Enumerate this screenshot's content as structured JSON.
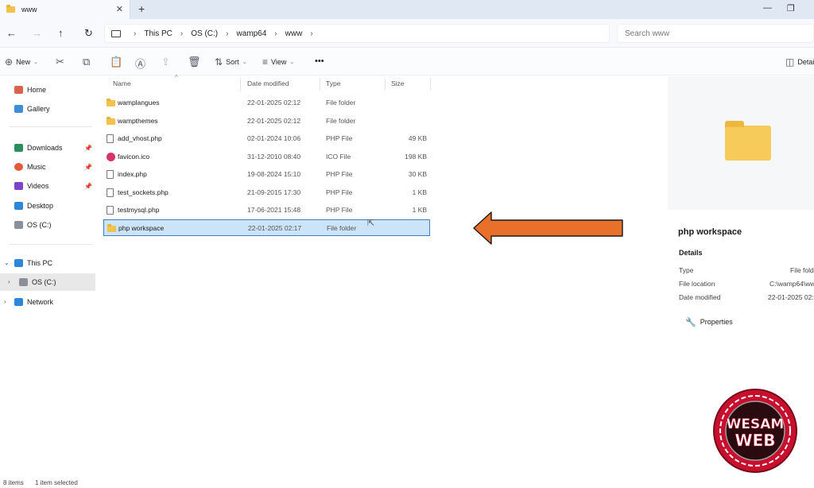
{
  "window": {
    "tab_title": "www",
    "tab_close": "✕",
    "new_tab": "+",
    "minimize": "—",
    "restore": "❐"
  },
  "address": {
    "breadcrumb": [
      "This PC",
      "OS (C:)",
      "wamp64",
      "www"
    ],
    "search_placeholder": "Search www"
  },
  "command_bar": {
    "new_label": "New",
    "sort_label": "Sort",
    "view_label": "View",
    "more_label": "•••",
    "details_label": "Detai"
  },
  "sidebar": {
    "items": [
      {
        "label": "Home",
        "icon": "home-icon",
        "color": "#d9634a"
      },
      {
        "label": "Gallery",
        "icon": "gallery-icon",
        "color": "#3c8fd6"
      },
      {
        "label": "Downloads",
        "icon": "downloads-icon",
        "color": "#2a8f5c",
        "pinned": true
      },
      {
        "label": "Music",
        "icon": "music-icon",
        "color": "#e25a3a",
        "pinned": true
      },
      {
        "label": "Videos",
        "icon": "videos-icon",
        "color": "#7a45c9",
        "pinned": true
      },
      {
        "label": "Desktop",
        "icon": "desktop-icon",
        "color": "#2c87d8"
      },
      {
        "label": "OS (C:)",
        "icon": "drive-icon",
        "color": "#8a8f99"
      },
      {
        "label": "This PC",
        "icon": "this-pc-icon",
        "color": "#2c87d8"
      },
      {
        "label": "OS (C:)",
        "icon": "drive-icon",
        "color": "#8a8f99"
      },
      {
        "label": "Network",
        "icon": "network-icon",
        "color": "#2c87d8"
      }
    ]
  },
  "file_list": {
    "columns": [
      "Name",
      "Date modified",
      "Type",
      "Size"
    ],
    "rows": [
      {
        "name": "wamplangues",
        "date": "22-01-2025 02:12",
        "type": "File folder",
        "size": "",
        "icon": "folder-icon"
      },
      {
        "name": "wampthemes",
        "date": "22-01-2025 02:12",
        "type": "File folder",
        "size": "",
        "icon": "folder-icon"
      },
      {
        "name": "add_vhost.php",
        "date": "02-01-2024 10:06",
        "type": "PHP File",
        "size": "49 KB",
        "icon": "php-file-icon"
      },
      {
        "name": "favicon.ico",
        "date": "31-12-2010 08:40",
        "type": "ICO File",
        "size": "198 KB",
        "icon": "ico-file-icon"
      },
      {
        "name": "index.php",
        "date": "19-08-2024 15:10",
        "type": "PHP File",
        "size": "30 KB",
        "icon": "php-file-icon"
      },
      {
        "name": "test_sockets.php",
        "date": "21-09-2015 17:30",
        "type": "PHP File",
        "size": "1 KB",
        "icon": "php-file-icon"
      },
      {
        "name": "testmysql.php",
        "date": "17-06-2021 15:48",
        "type": "PHP File",
        "size": "1 KB",
        "icon": "php-file-icon"
      },
      {
        "name": "php workspace",
        "date": "22-01-2025 02:17",
        "type": "File folder",
        "size": "",
        "icon": "folder-icon",
        "selected": true
      }
    ]
  },
  "details_pane": {
    "title": "php workspace",
    "section": "Details",
    "fields": [
      {
        "label": "Type",
        "value": "File fold"
      },
      {
        "label": "File location",
        "value": "C:\\wamp64\\ww"
      },
      {
        "label": "Date modified",
        "value": "22-01-2025 02:1"
      }
    ],
    "properties_label": "Properties"
  },
  "status": {
    "items_count": "8 items",
    "selected_count": "1 item selected"
  },
  "logo": {
    "line1": "WESAM",
    "line2": "WEB"
  },
  "colors": {
    "arrow": "#e8702a",
    "selection": "#cce4f7",
    "logo_red": "#c8102e"
  }
}
